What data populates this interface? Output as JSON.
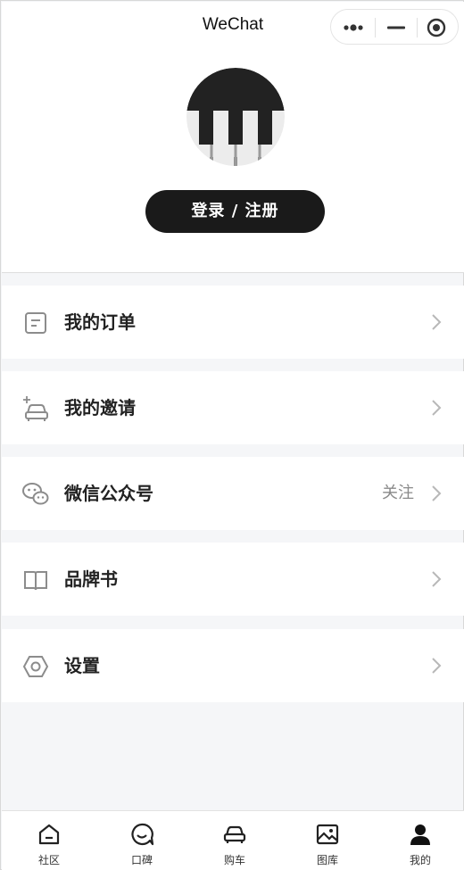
{
  "window": {
    "title": "WeChat"
  },
  "capsule": {
    "more_icon": "more-dots-icon",
    "minimize_icon": "minimize-icon",
    "close_icon": "target-circle-icon"
  },
  "profile": {
    "avatar_icon": "piano-keys-avatar",
    "login_label": "登录 / 注册"
  },
  "menu": {
    "items": [
      {
        "label": "我的订单",
        "extra": "",
        "icon": "order-document-icon"
      },
      {
        "label": "我的邀请",
        "extra": "",
        "icon": "car-sparkle-icon"
      },
      {
        "label": "微信公众号",
        "extra": "关注",
        "icon": "wechat-icon"
      },
      {
        "label": "品牌书",
        "extra": "",
        "icon": "open-book-icon"
      },
      {
        "label": "设置",
        "extra": "",
        "icon": "hexagon-settings-icon"
      }
    ]
  },
  "tabbar": {
    "tabs": [
      {
        "label": "社区",
        "icon": "home-icon",
        "active": false
      },
      {
        "label": "口碑",
        "icon": "chat-bubble-icon",
        "active": false
      },
      {
        "label": "购车",
        "icon": "car-icon",
        "active": false
      },
      {
        "label": "图库",
        "icon": "image-icon",
        "active": false
      },
      {
        "label": "我的",
        "icon": "person-icon",
        "active": true
      }
    ]
  },
  "colors": {
    "background": "#f5f6f8",
    "button_dark": "#1a1a1a",
    "icon_gray": "#8c8c8c",
    "text_dark": "#222222"
  }
}
